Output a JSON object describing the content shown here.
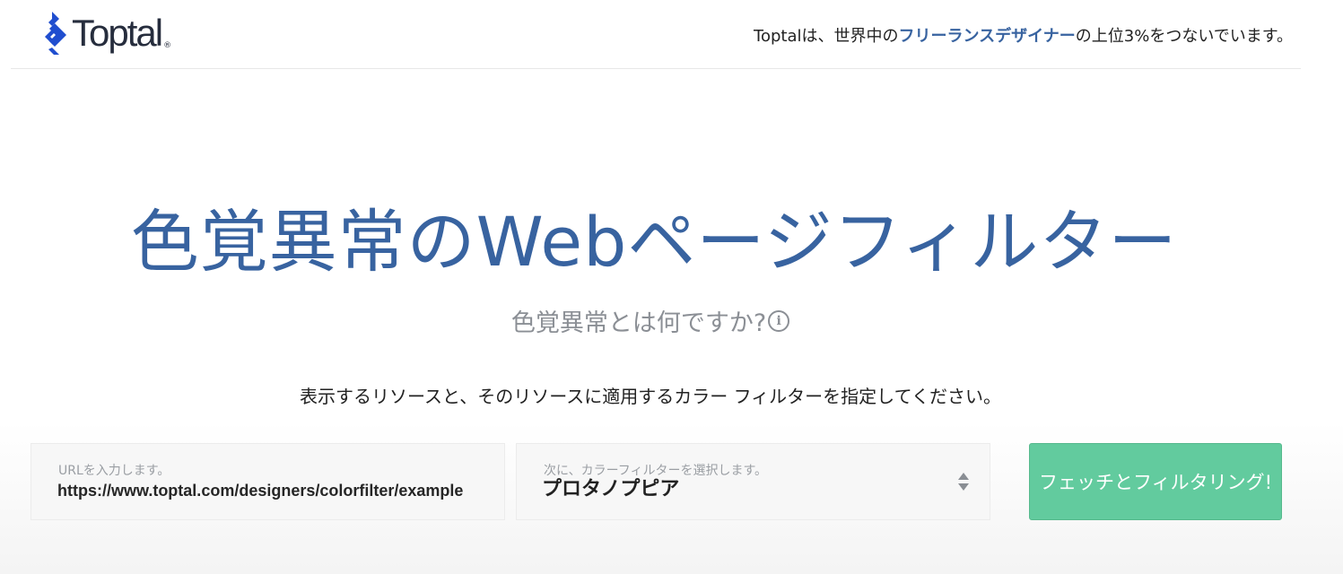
{
  "header": {
    "logo_text": "Toptal",
    "logo_reg": "®",
    "tagline_before": "Toptalは、世界中の",
    "tagline_link": "フリーランスデザイナー",
    "tagline_after": "の上位3%をつないでいます。"
  },
  "hero": {
    "title": "色覚異常のWebページフィルター",
    "subtitle": "色覚異常とは何ですか?",
    "instruction": "表示するリソースと、そのリソースに適用するカラー フィルターを指定してください。"
  },
  "form": {
    "url_label": "URLを入力します。",
    "url_value": "https://www.toptal.com/designers/colorfilter/example",
    "filter_label": "次に、カラーフィルターを選択します。",
    "filter_value": "プロタノプピア",
    "submit_label": "フェッチとフィルタリング!"
  },
  "icons": {
    "logo": "toptal-logo-icon",
    "info": "info-icon",
    "select": "select-arrows-icon"
  },
  "colors": {
    "brand_blue": "#3863a0",
    "button_green": "#62cb9e",
    "muted_gray": "#8b8f95"
  }
}
